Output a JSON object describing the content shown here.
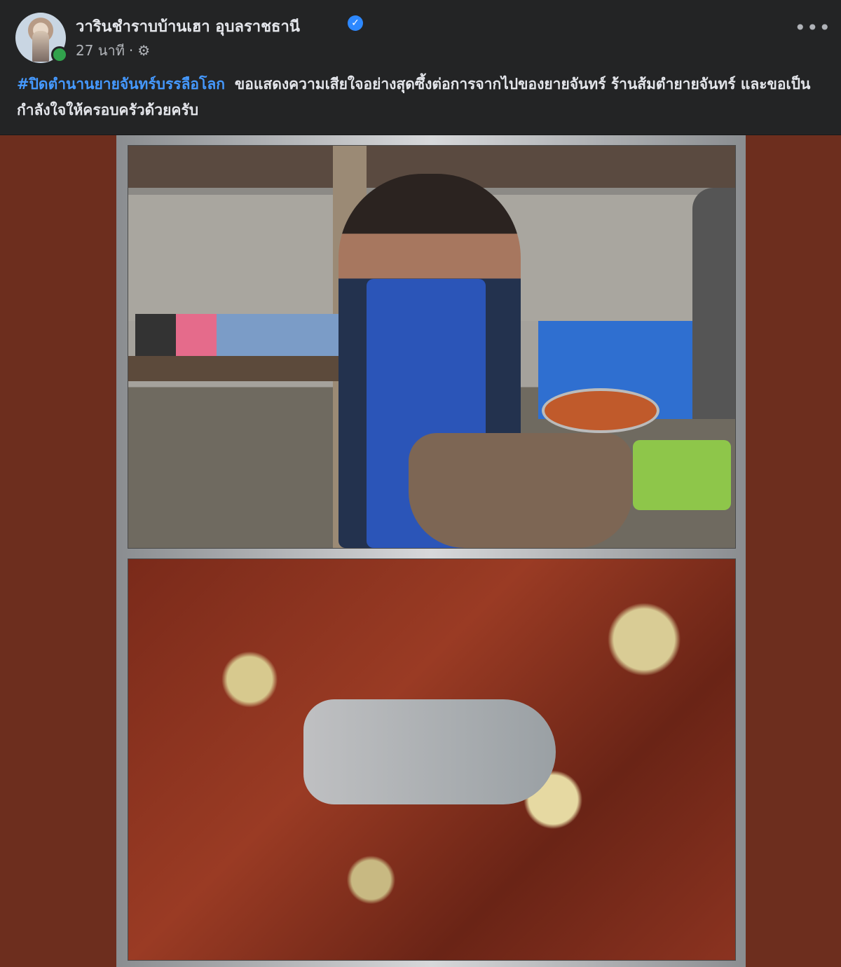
{
  "post": {
    "page_name": "วารินชำราบบ้านเฮา อุบลราชธานี",
    "verified_icon": "verified-badge-icon",
    "time": "27 นาที",
    "separator": "·",
    "audience_icon": "gear-icon",
    "more_icon": "more-options-icon",
    "hashtag": "#ปิดตำนานยายจันทร์บรรลือโลก",
    "caption": "ขอแสดงความเสียใจอย่างสุดซึ้งต่อการจากไปของยายจันทร์ ร้านส้มตำยายจันทร์ และขอเป็นกำลังใจให้ครอบครัวด้วยครับ"
  },
  "colors": {
    "header_bg": "#232425",
    "text_primary": "#e4e6eb",
    "text_secondary": "#b0b3b8",
    "link": "#4599ff",
    "verified": "#2d88ff",
    "online": "#31a24c",
    "media_bg": "#6d2e1e"
  }
}
